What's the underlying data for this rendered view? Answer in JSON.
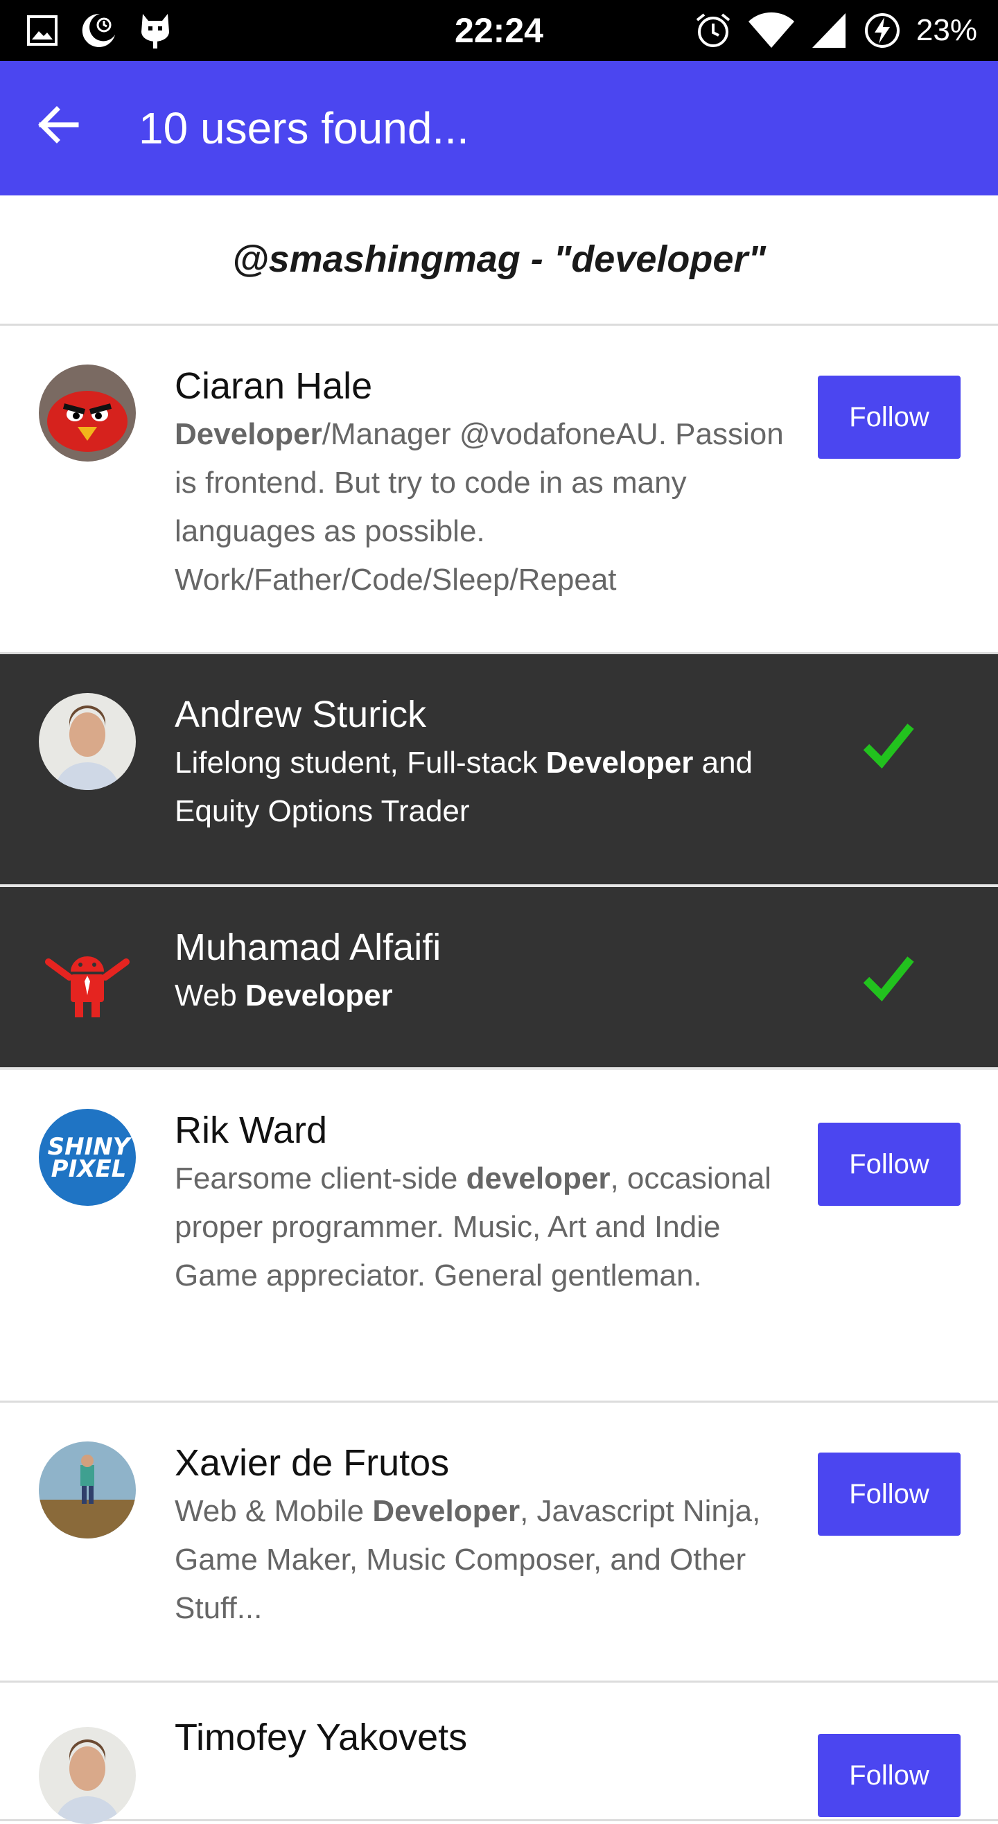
{
  "status_bar": {
    "time": "22:24",
    "battery_percent": "23%",
    "icons_left": [
      "image-icon",
      "moon-icon",
      "cyanogen-icon"
    ],
    "icons_right": [
      "alarm-icon",
      "wifi-icon",
      "signal-icon",
      "battery-charging-icon"
    ]
  },
  "app_bar": {
    "title": "10 users found...",
    "background": "#4b46f0"
  },
  "query": {
    "text": "@smashingmag - \"developer\""
  },
  "users": [
    {
      "name": "Ciaran Hale",
      "bio_parts": [
        {
          "text": "Developer",
          "bold": true
        },
        {
          "text": "/Manager @vodafoneAU. Passion is frontend. But try to code in as many languages as possible. Work/Father/Code/Sleep/Repeat",
          "bold": false
        }
      ],
      "followed": false,
      "button_label": "Follow",
      "avatar": "angry-bird-avatar"
    },
    {
      "name": "Andrew Sturick",
      "bio_parts": [
        {
          "text": "Lifelong student, Full-stack ",
          "bold": false
        },
        {
          "text": "Developer",
          "bold": true
        },
        {
          "text": " and Equity Options Trader",
          "bold": false
        }
      ],
      "followed": true,
      "avatar": "portrait-avatar"
    },
    {
      "name": "Muhamad Alfaifi",
      "bio_parts": [
        {
          "text": "Web ",
          "bold": false
        },
        {
          "text": "Developer",
          "bold": true
        }
      ],
      "followed": true,
      "avatar": "red-android-avatar"
    },
    {
      "name": "Rik Ward",
      "bio_parts": [
        {
          "text": "Fearsome client-side ",
          "bold": false
        },
        {
          "text": "developer",
          "bold": true
        },
        {
          "text": ", occasional proper programmer. Music, Art and Indie Game appreciator. General gentleman.",
          "bold": false
        }
      ],
      "followed": false,
      "button_label": "Follow",
      "avatar": "shiny-pixel-avatar",
      "avatar_text": [
        "SHINY",
        "PIXEL"
      ]
    },
    {
      "name": "Xavier de Frutos",
      "bio_parts": [
        {
          "text": "Web & Mobile ",
          "bold": false
        },
        {
          "text": "Developer",
          "bold": true
        },
        {
          "text": ", Javascript Ninja, Game Maker, Music Composer, and Other Stuff...",
          "bold": false
        }
      ],
      "followed": false,
      "button_label": "Follow",
      "avatar": "landscape-avatar"
    },
    {
      "name": "Timofey Yakovets",
      "bio_parts": [],
      "followed": false,
      "button_label": "Follow",
      "avatar": "portrait-avatar"
    }
  ],
  "colors": {
    "accent": "#4b46f0",
    "followed_row": "#333333",
    "check": "#22c21e"
  }
}
